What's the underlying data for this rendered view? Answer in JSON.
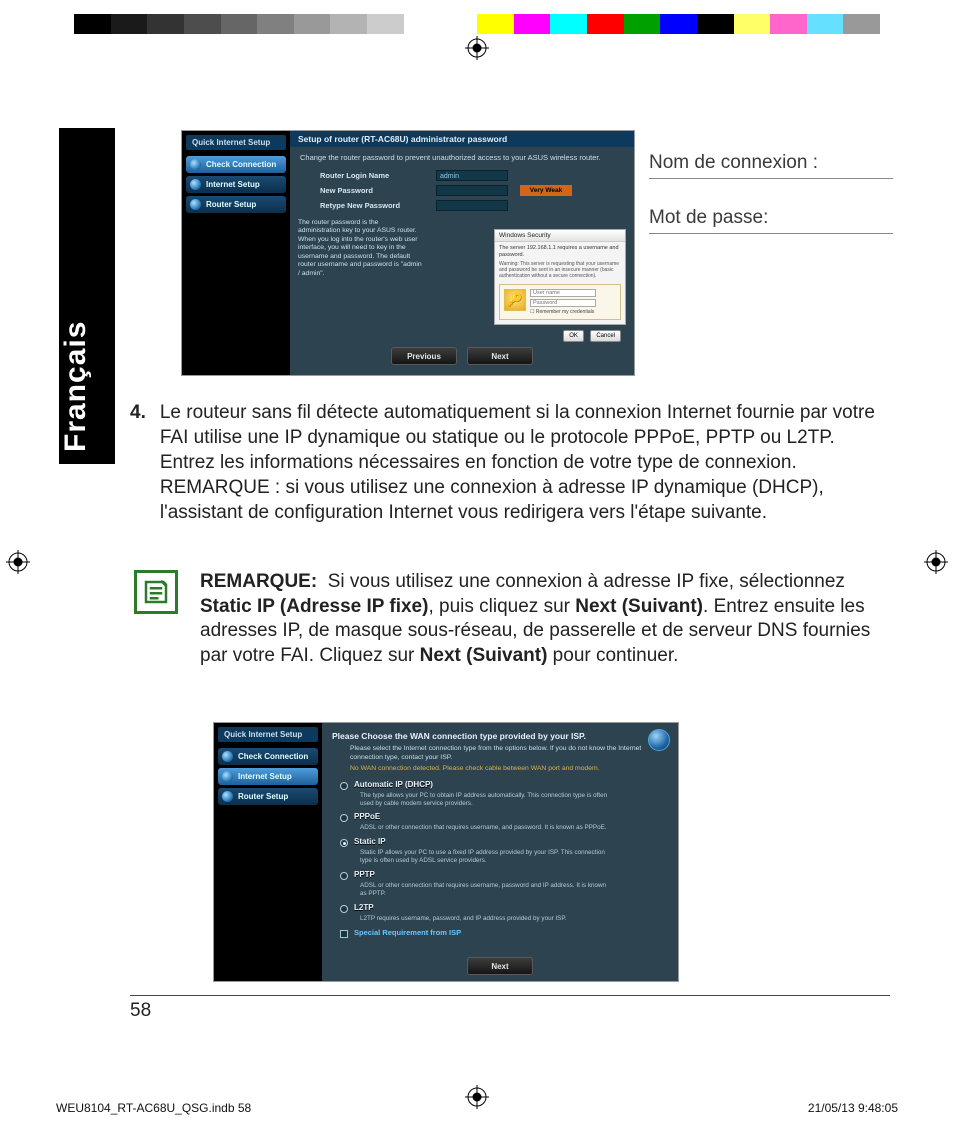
{
  "colorbar": [
    "#000000",
    "#1a1a1a",
    "#333333",
    "#4d4d4d",
    "#666666",
    "#808080",
    "#999999",
    "#b3b3b3",
    "#cccccc",
    "#ffffff",
    "#ffffff",
    "#ffff00",
    "#ff00ff",
    "#00ffff",
    "#ff0000",
    "#00a000",
    "#0000ff",
    "#000000",
    "#ffff66",
    "#ff66cc",
    "#66e0ff",
    "#999999"
  ],
  "lang_tab": "Français",
  "labels": {
    "login": "Nom de connexion :",
    "password": "Mot de passe:"
  },
  "step4": {
    "num": "4.",
    "text": "Le routeur sans fil détecte automatiquement si la connexion Internet fournie par votre FAI utilise une IP dynamique ou statique ou le protocole PPPoE, PPTP ou L2TP. Entrez les informations nécessaires en fonction de votre type de connexion. REMARQUE : si vous utilisez une connexion à adresse IP dynamique (DHCP), l'assistant de configuration Internet vous redirigera vers l'étape suivante."
  },
  "remark": {
    "label": "REMARQUE:",
    "t1": "Si vous utilisez une connexion à adresse IP fixe, sélectionnez ",
    "b1": "Static IP (Adresse IP fixe)",
    "t2": ", puis cliquez sur ",
    "b2": "Next (Suivant)",
    "t3": ". Entrez ensuite les adresses IP, de masque sous-réseau, de passerelle et de serveur DNS fournies par votre FAI. Cliquez sur ",
    "b3": "Next (Suivant)",
    "t4": " pour continuer."
  },
  "shot1": {
    "qis_title": "Quick Internet Setup",
    "items": [
      "Check Connection",
      "Internet Setup",
      "Router Setup"
    ],
    "title": "Setup of router (RT-AC68U) administrator password",
    "subtext": "Change the router password to prevent unauthorized access to your ASUS wireless router.",
    "fields": {
      "login_label": "Router Login Name",
      "login_value": "admin",
      "newpw_label": "New Password",
      "strength": "Very Weak",
      "retype_label": "Retype New Password"
    },
    "note": "The router password is the administration key to your ASUS router. When you log into the router's web user interface, you will need to key in the username and password. The default router username and password is \"admin / admin\".",
    "winsec": {
      "title": "Windows Security",
      "body": "The server 192.168.1.1 requires a username and password.",
      "warn": "Warning: This server is requesting that your username and password be sent in an insecure manner (basic authentication without a secure connection).",
      "user_ph": "User name",
      "pass_ph": "Password",
      "remember": "Remember my credentials",
      "ok": "OK",
      "cancel": "Cancel"
    },
    "btn_prev": "Previous",
    "btn_next": "Next"
  },
  "shot2": {
    "qis_title": "Quick Internet Setup",
    "items": [
      "Check Connection",
      "Internet Setup",
      "Router Setup"
    ],
    "title": "Please Choose the WAN connection type provided by your ISP.",
    "intro": "Please select the Internet connection type from the options below. If you do not know the Internet connection type, contact your ISP.",
    "nowan": "No WAN connection detected. Please check cable between WAN port and modem.",
    "opts": [
      {
        "label": "Automatic IP (DHCP)",
        "desc": "The type allows your PC to obtain IP address automatically. This connection type is often used by cable modem service providers."
      },
      {
        "label": "PPPoE",
        "desc": "ADSL or other connection that requires username, and password. It is known as PPPoE."
      },
      {
        "label": "Static IP",
        "desc": "Static IP allows your PC to use a fixed IP address provided by your ISP. This connection type is often used by ADSL service providers."
      },
      {
        "label": "PPTP",
        "desc": "ADSL or other connection that requires username, password and IP address. It is known as PPTP."
      },
      {
        "label": "L2TP",
        "desc": "L2TP requires username, password, and IP address provided by your ISP."
      }
    ],
    "special": "Special Requirement from ISP",
    "btn_next": "Next"
  },
  "page_number": "58",
  "footer": {
    "file": "WEU8104_RT-AC68U_QSG.indb   58",
    "datetime": "21/05/13   9:48:05"
  }
}
